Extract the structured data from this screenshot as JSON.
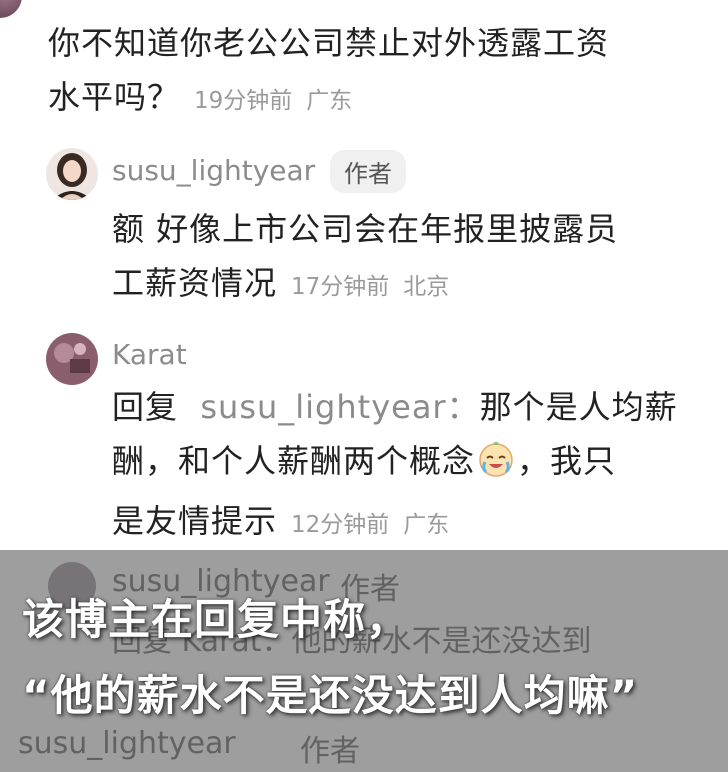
{
  "comments": {
    "c1": {
      "line1": "你不知道你老公公司禁止对外透露工资",
      "line2": "水平吗？",
      "time": "19分钟前",
      "location": "广东"
    },
    "c2": {
      "username": "susu_lightyear",
      "badge": "作者",
      "line1": "额 好像上市公司会在年报里披露员",
      "line2": "工薪资情况",
      "time": "17分钟前",
      "location": "北京"
    },
    "c3": {
      "username": "Karat",
      "reply_word": "回复",
      "reply_target": "susu_lightyear：",
      "line1_rest": "那个是人均薪",
      "line2": "酬，和个人薪酬两个概念",
      "emoji": "crying-laughing-emoji",
      "line2_end": "，我只",
      "line3": "是友情提示",
      "time": "12分钟前",
      "location": "广东"
    }
  },
  "background_comments": {
    "username": "susu_lightyear",
    "badge": "作者",
    "reply_line": "回复 Karat：他的薪水不是还没达到",
    "username2": "susu_lightyear",
    "badge2": "作者"
  },
  "caption": {
    "line1": "该博主在回复中称，",
    "line2": "“他的薪水不是还没达到人均嘛”"
  }
}
